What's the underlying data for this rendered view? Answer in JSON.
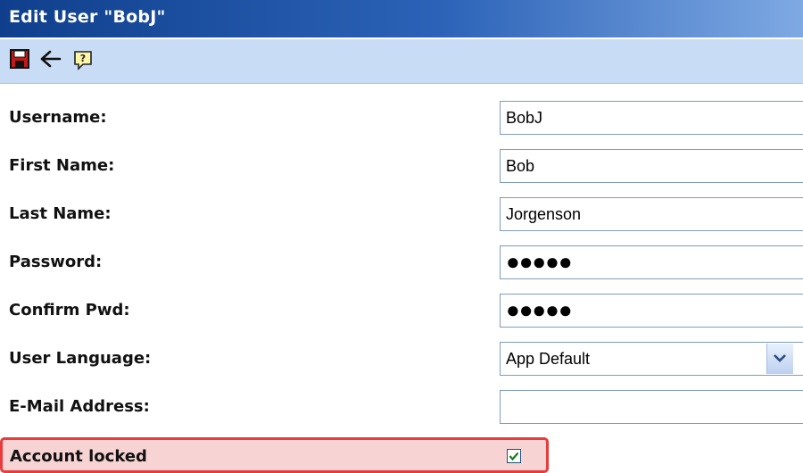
{
  "window": {
    "title": "Edit User \"BobJ\""
  },
  "toolbar": {
    "icons": [
      "save-icon",
      "back-arrow-icon",
      "help-icon"
    ]
  },
  "form": {
    "username": {
      "label": "Username:",
      "value": "BobJ"
    },
    "first_name": {
      "label": "First Name:",
      "value": "Bob"
    },
    "last_name": {
      "label": "Last Name:",
      "value": "Jorgenson"
    },
    "password": {
      "label": "Password:",
      "value": "●●●●●"
    },
    "confirm_pwd": {
      "label": "Confirm Pwd:",
      "value": "●●●●●"
    },
    "user_language": {
      "label": "User Language:",
      "value": "App Default"
    },
    "email": {
      "label": "E-Mail Address:",
      "value": ""
    },
    "account_locked": {
      "label": "Account locked",
      "checked": true
    }
  },
  "colors": {
    "title_bar": "#1a4a9a",
    "toolbar": "#c8dcf6",
    "highlight_border": "#e83b3b",
    "highlight_fill": "#f7d3d3"
  }
}
